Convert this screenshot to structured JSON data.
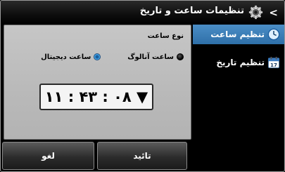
{
  "header": {
    "title": "تنظیمات ساعت و تاریخ",
    "back_label": "<",
    "icon": "gear-icon"
  },
  "sidebar": {
    "items": [
      {
        "label": "تنظیم ساعت",
        "icon": "clock-icon",
        "selected": true
      },
      {
        "label": "تنظیم تاریخ",
        "icon": "calendar-icon",
        "calendar_number": "17",
        "selected": false
      }
    ]
  },
  "panel": {
    "time_type_label": "نوع ساعت",
    "options": [
      {
        "label": "ساعت آنالوگ",
        "selected": false
      },
      {
        "label": "ساعت دیجیتال",
        "selected": true
      }
    ],
    "clock_value": "۱۱ : ۴۳ : ۰۸ ▼"
  },
  "buttons": {
    "confirm": "تائید",
    "cancel": "لغو"
  },
  "colors": {
    "accent": "#3a7fbf",
    "panel_bg": "#bdbdbd",
    "background": "#000000"
  }
}
